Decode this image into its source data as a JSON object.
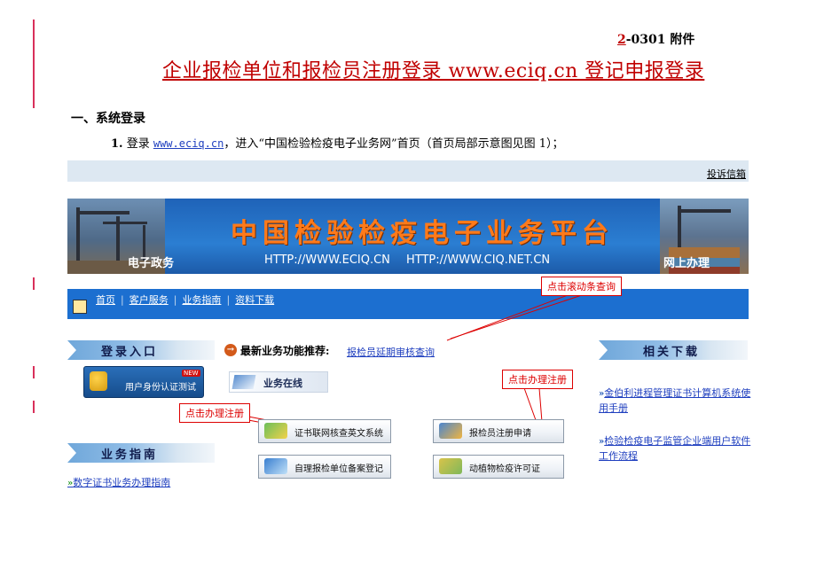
{
  "doc": {
    "code_num": "2",
    "code_rest": "-0301 附件",
    "title": "企业报检单位和报检员注册登录 www.eciq.cn 登记申报登录",
    "section_heading": "一、系统登录",
    "step_number": "1.",
    "step_prefix": " 登录 ",
    "step_link": "www.eciq.cn",
    "step_suffix": "，进入“中国检验检疫电子业务网”首页（首页局部示意图见图 1）；"
  },
  "site": {
    "complaint_link": "投诉信箱",
    "banner_title": "中国检验检疫电子业务平台",
    "banner_url1": "HTTP://WWW.ECIQ.CN",
    "banner_url2": "HTTP://WWW.CIQ.NET.CN",
    "banner_tag_left": "电子政务",
    "banner_tag_right": "网上办理",
    "nav": [
      "首页",
      "客户服务",
      "业务指南",
      "资料下载"
    ],
    "left": {
      "login_header": "登录入口",
      "login_button": "用户身份认证测试",
      "login_new": "NEW",
      "guide_header": "业务指南",
      "guide_link": "数字证书业务办理指南"
    },
    "center": {
      "rec_icon": "→",
      "rec_label": "最新业务功能推荐:",
      "rec_link": "报检员延期审核查询",
      "biz_online": "业务在线",
      "buttons": [
        {
          "label": "证书联网核查英文系统",
          "icon": "certificate-icon"
        },
        {
          "label": "报检员注册申请",
          "icon": "people-icon"
        },
        {
          "label": "自理报检单位备案登记",
          "icon": "register-icon"
        },
        {
          "label": "动植物检疫许可证",
          "icon": "license-icon"
        }
      ]
    },
    "right": {
      "download_header": "相关下载",
      "links": [
        "金伯利进程管理证书计算机系统使用手册",
        "检验检疫电子监管企业端用户软件工作流程"
      ]
    }
  },
  "callouts": {
    "scroll": "点击滚动条查询",
    "register_right": "点击办理注册",
    "register_left": "点击办理注册"
  },
  "colors": {
    "accent_red": "#c00000",
    "link_blue": "#1f3fbf",
    "nav_blue": "#1c6fd0",
    "banner_title_orange": "#ff7a1a"
  }
}
